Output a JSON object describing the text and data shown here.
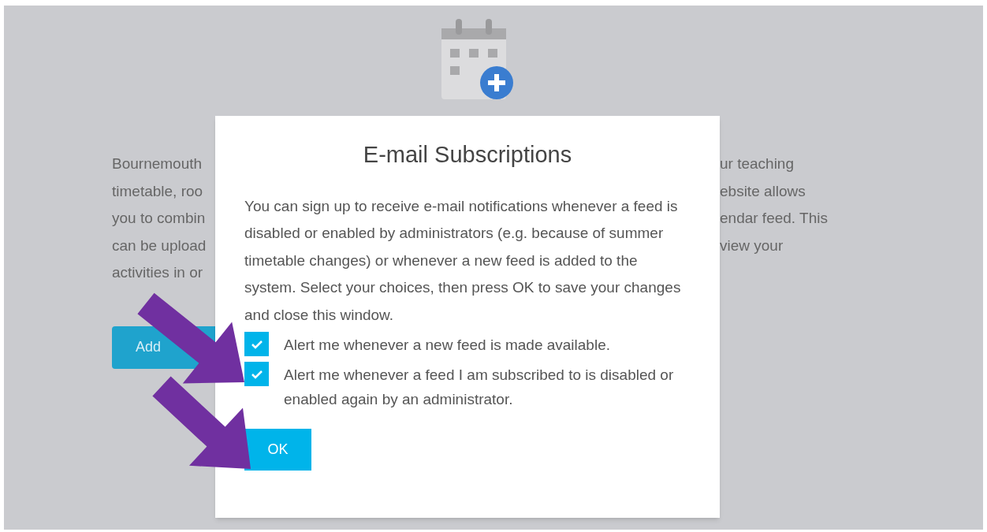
{
  "background": {
    "paragraph_left": [
      "Bournemouth",
      "timetable, roo",
      "you to combin",
      "can be upload",
      "activities in or"
    ],
    "paragraph_right": [
      "ur teaching",
      "ebsite allows",
      "endar feed. This",
      "view your"
    ],
    "add_button": "Add"
  },
  "dialog": {
    "title": "E-mail Subscriptions",
    "description": "You can sign up to receive e-mail notifications whenever a feed is disabled or enabled by administrators (e.g. because of summer timetable changes) or whenever a new feed is added to the system. Select your choices, then press OK to save your changes and close this window.",
    "options": [
      {
        "label": "Alert me whenever a new feed is made available.",
        "checked": true
      },
      {
        "label": "Alert me whenever a feed I am subscribed to is disabled or enabled again by an administrator.",
        "checked": true
      }
    ],
    "ok_button": "OK"
  }
}
